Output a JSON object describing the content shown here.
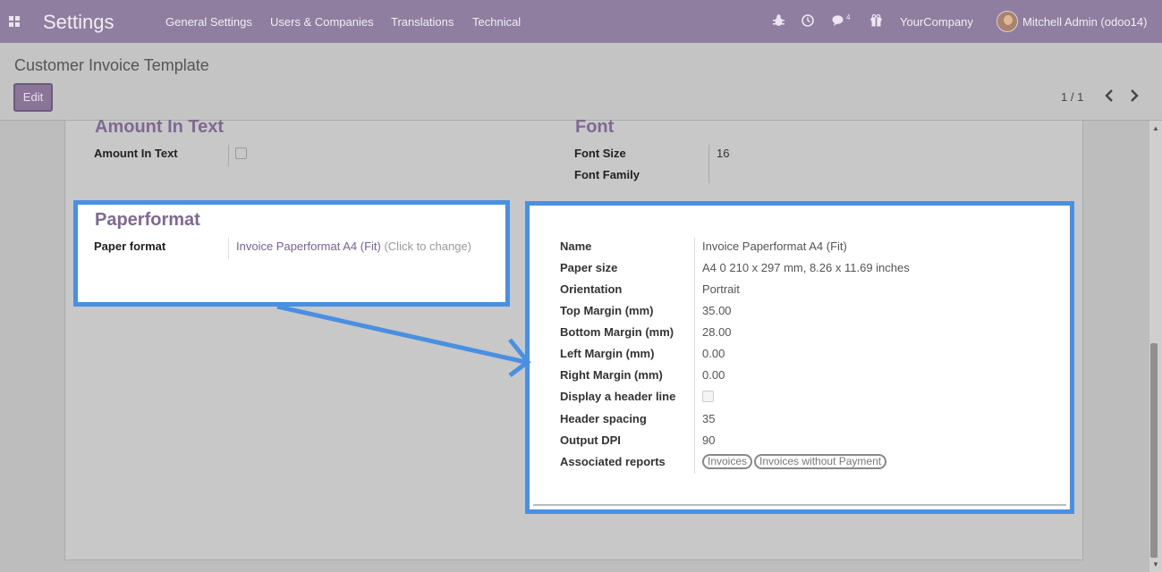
{
  "navbar": {
    "brand": "Settings",
    "menu": [
      "General Settings",
      "Users & Companies",
      "Translations",
      "Technical"
    ],
    "chat_count": "4",
    "company": "YourCompany",
    "user": "Mitchell Admin (odoo14)"
  },
  "control": {
    "title": "Customer Invoice Template",
    "edit_label": "Edit",
    "pager": "1 / 1"
  },
  "form": {
    "amount_section": "Amount In Text",
    "amount_label": "Amount In Text",
    "font_section": "Font",
    "font_size_label": "Font Size",
    "font_size_value": "16",
    "font_family_label": "Font Family",
    "paper_section": "Paperformat",
    "paper_label": "Paper format",
    "paper_value": "Invoice Paperformat A4 (Fit)",
    "paper_hint": "(Click to change)"
  },
  "paperformat_detail": {
    "name_label": "Name",
    "name_value": "Invoice Paperformat A4 (Fit)",
    "size_label": "Paper size",
    "size_value": "A4 0 210 x 297 mm, 8.26 x 11.69 inches",
    "orientation_label": "Orientation",
    "orientation_value": "Portrait",
    "top_label": "Top Margin (mm)",
    "top_value": "35.00",
    "bottom_label": "Bottom Margin (mm)",
    "bottom_value": "28.00",
    "left_label": "Left Margin (mm)",
    "left_value": "0.00",
    "right_label": "Right Margin (mm)",
    "right_value": "0.00",
    "header_line_label": "Display a header line",
    "spacing_label": "Header spacing",
    "spacing_value": "35",
    "dpi_label": "Output DPI",
    "dpi_value": "90",
    "reports_label": "Associated reports",
    "reports": [
      "Invoices",
      "Invoices without Payment"
    ]
  }
}
